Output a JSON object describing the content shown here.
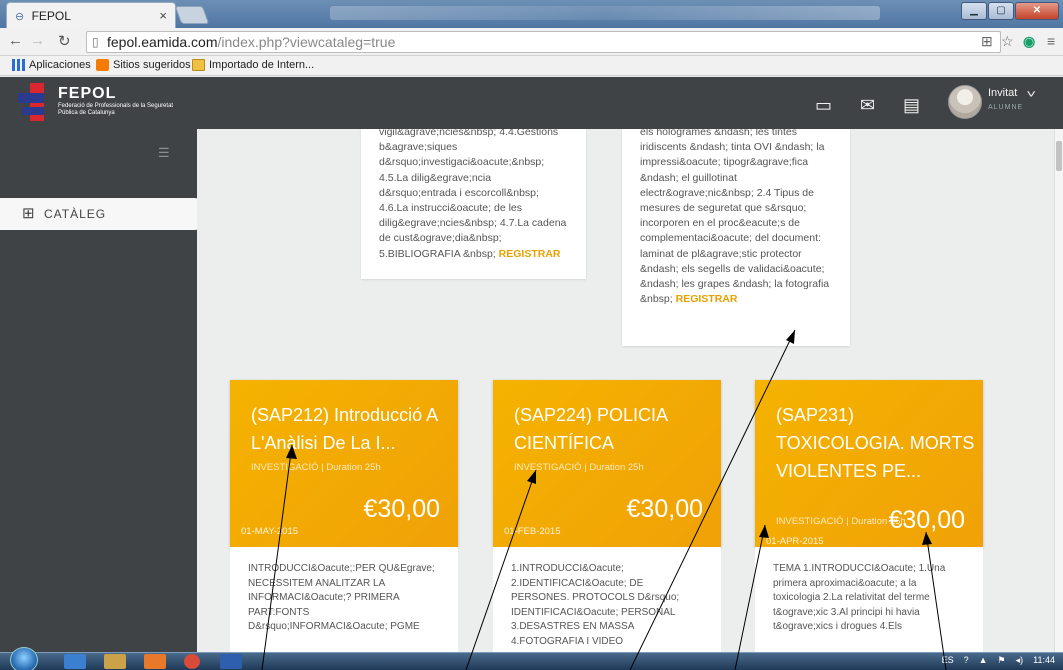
{
  "browser": {
    "tab_title": "FEPOL",
    "tab_close": "×",
    "url_host": "fepol.eamida.com",
    "url_path": "/index.php?viewcataleg=true",
    "bookmarks": [
      {
        "label": "Aplicaciones",
        "icon": "apps-grid-icon",
        "color": "#2a6dd4"
      },
      {
        "label": "Sitios sugeridos",
        "icon": "suggested-sites-icon",
        "color": "#f57c00"
      },
      {
        "label": "Importado de Intern...",
        "icon": "folder-icon",
        "color": "#f0c040"
      }
    ]
  },
  "app": {
    "logo_name": "FEPOL",
    "logo_subtitle": "Federació de Professionals de la Seguretat Pública de Catalunya",
    "user_name": "Invitat",
    "user_role": "ALUMNE",
    "topbar_icons": [
      "window-icon",
      "mail-icon",
      "list-icon"
    ],
    "sidebar": {
      "items": [
        {
          "label": "CATÀLEG",
          "icon": "grid-icon"
        }
      ]
    },
    "colors": {
      "accent": "#f5b300",
      "register": "#e7a200",
      "topbar": "#3f4345"
    }
  },
  "upper_cards": [
    {
      "text": "vigil&agrave;ncies&nbsp; 4.4.Gestions b&agrave;siques d&rsquo;investigaci&oacute;&nbsp; 4.5.La dilig&egrave;ncia d&rsquo;entrada i escorcoll&nbsp; 4.6.La instrucci&oacute; de les dilig&egrave;ncies&nbsp; 4.7.La cadena de cust&ograve;dia&nbsp; 5.BIBLIOGRAFIA &nbsp;",
      "register": "REGISTRAR"
    },
    {
      "text": "els hologrames &ndash; les tintes iridiscents &ndash; tinta OVI &ndash; la impressi&oacute; tipogr&agrave;fica &ndash; el guillotinat electr&ograve;nic&nbsp; 2.4 Tipus de mesures de seguretat que s&rsquo; incorporen en el proc&eacute;s de complementaci&oacute; del document: laminat de pl&agrave;stic protector &ndash; els segells de validaci&oacute; &ndash; les grapes &ndash; la fotografia &nbsp;",
      "register": "REGISTRAR"
    }
  ],
  "courses": [
    {
      "title": "(SAP212) Introducció A L'Anàlisi De La I...",
      "category": "INVESTIGACIÓ | Duration 25h",
      "price": "€30,00",
      "date": "01-MAY-2015",
      "description": "INTRODUCCI&Oacute;:PER QU&Egrave; NECESSITEM ANALITZAR LA INFORMACI&Oacute;? PRIMERA PART:FONTS D&rsquo;INFORMACI&Oacute; PGME"
    },
    {
      "title": "(SAP224) POLICIA CIENTÍFICA",
      "category": "INVESTIGACIÓ | Duration 25h",
      "price": "€30,00",
      "date": "01-FEB-2015",
      "description": "1.INTRODUCCI&Oacute; 2.IDENTIFICACI&Oacute; DE PERSONES. PROTOCOLS D&rsquo; IDENTIFICACI&Oacute; PERSONAL 3.DESASTRES EN MASSA 4.FOTOGRAFIA I VIDEO"
    },
    {
      "title": "(SAP231) TOXICOLOGIA. MORTS VIOLENTES PE...",
      "category": "INVESTIGACIÓ | Duration 25h",
      "price": "€30,00",
      "date": "01-APR-2015",
      "description": "TEMA 1.INTRODUCCI&Oacute; 1.Una primera aproximaci&oacute; a la toxicologia 2.La relativitat del terme t&ograve;xic 3.Al principi hi havia t&ograve;xics i drogues 4.Els"
    }
  ],
  "taskbar": {
    "lang": "ES",
    "time": "11:44"
  }
}
